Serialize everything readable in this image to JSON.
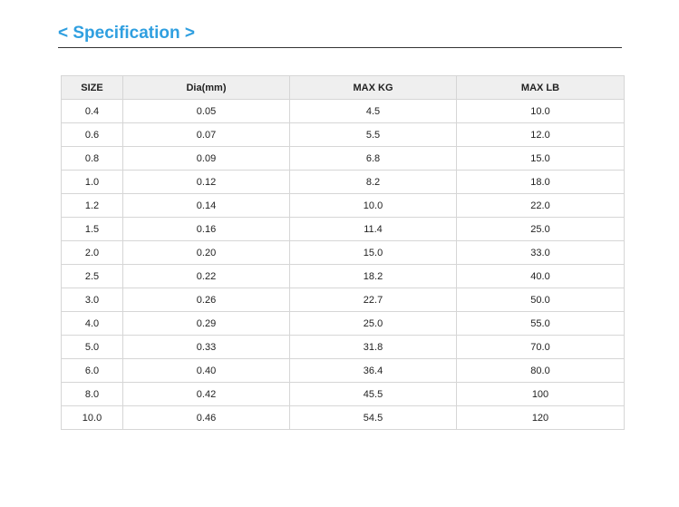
{
  "title": "< Specification >",
  "colors": {
    "accent": "#2f9fe0",
    "header_bg": "#efefef",
    "border": "#d6d6d6"
  },
  "table": {
    "headers": [
      "SIZE",
      "Dia(mm)",
      "MAX KG",
      "MAX LB"
    ],
    "rows": [
      [
        "0.4",
        "0.05",
        "4.5",
        "10.0"
      ],
      [
        "0.6",
        "0.07",
        "5.5",
        "12.0"
      ],
      [
        "0.8",
        "0.09",
        "6.8",
        "15.0"
      ],
      [
        "1.0",
        "0.12",
        "8.2",
        "18.0"
      ],
      [
        "1.2",
        "0.14",
        "10.0",
        "22.0"
      ],
      [
        "1.5",
        "0.16",
        "11.4",
        "25.0"
      ],
      [
        "2.0",
        "0.20",
        "15.0",
        "33.0"
      ],
      [
        "2.5",
        "0.22",
        "18.2",
        "40.0"
      ],
      [
        "3.0",
        "0.26",
        "22.7",
        "50.0"
      ],
      [
        "4.0",
        "0.29",
        "25.0",
        "55.0"
      ],
      [
        "5.0",
        "0.33",
        "31.8",
        "70.0"
      ],
      [
        "6.0",
        "0.40",
        "36.4",
        "80.0"
      ],
      [
        "8.0",
        "0.42",
        "45.5",
        "100"
      ],
      [
        "10.0",
        "0.46",
        "54.5",
        "120"
      ]
    ]
  }
}
